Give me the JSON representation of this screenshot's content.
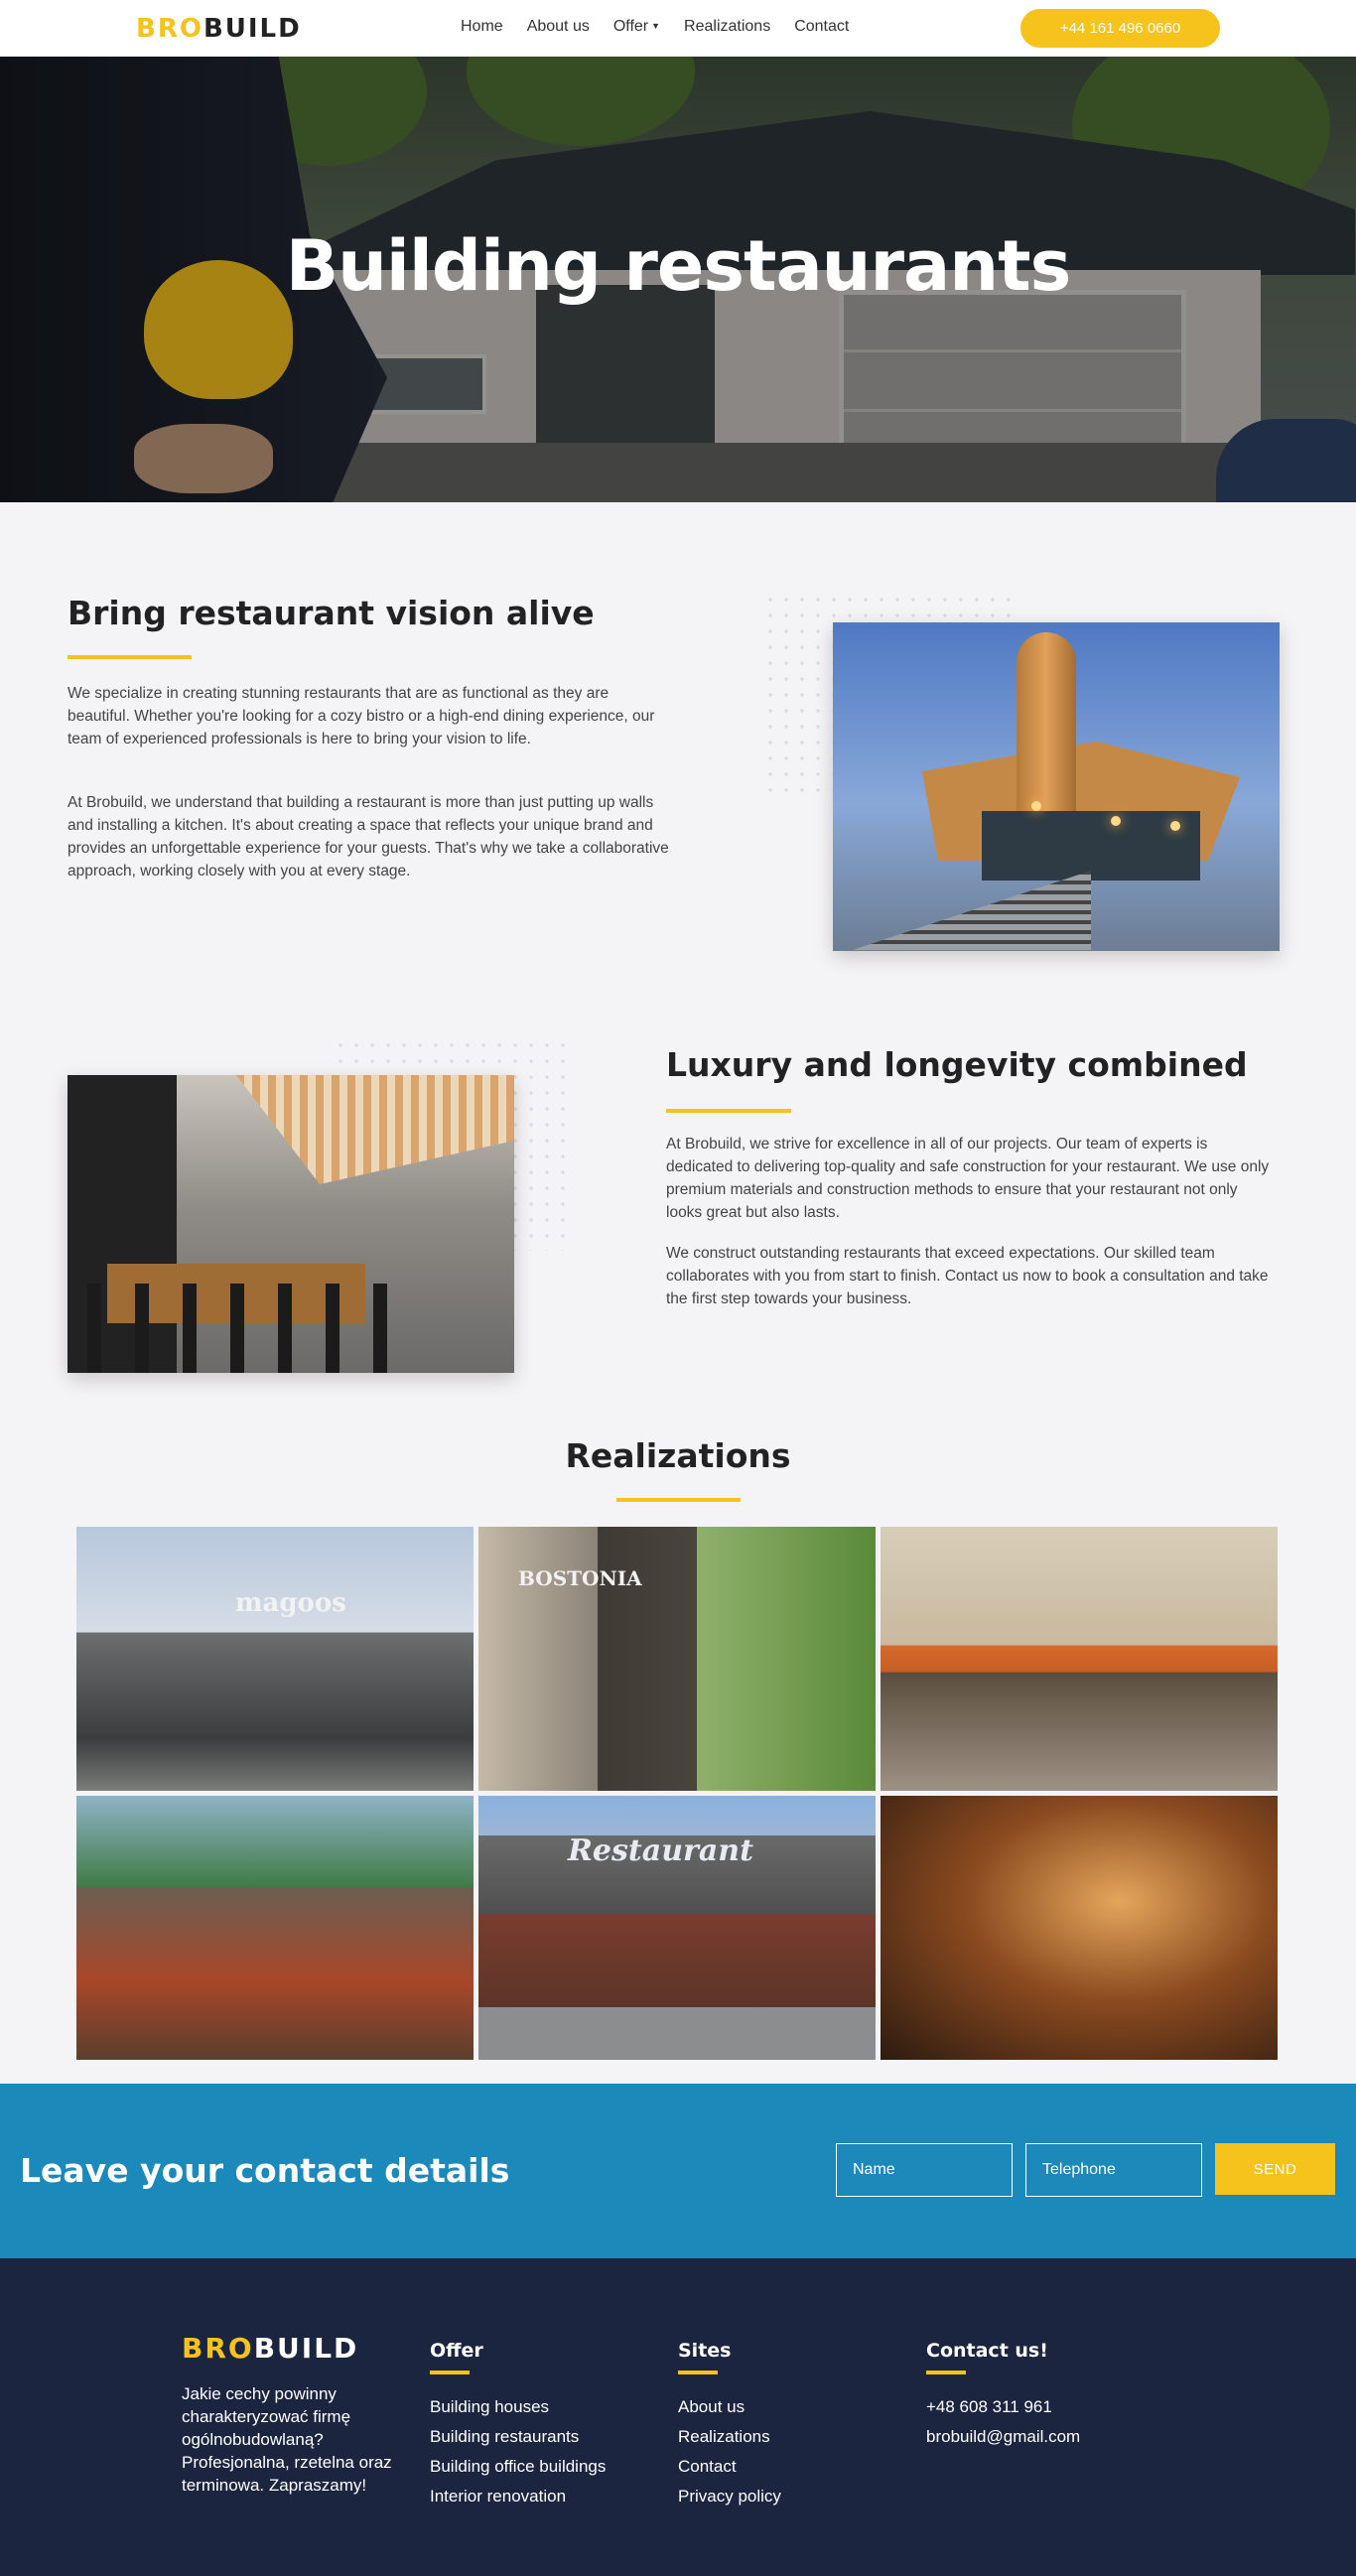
{
  "brand": {
    "part1": "BRO",
    "part2": "BUILD"
  },
  "nav": {
    "items": [
      "Home",
      "About us",
      "Offer",
      "Realizations",
      "Contact"
    ],
    "phone": "+44 161 496 0660"
  },
  "hero": {
    "title": "Building restaurants"
  },
  "section1": {
    "title": "Bring restaurant vision alive",
    "p1": "We specialize in creating stunning restaurants that are as functional as they are beautiful. Whether you're looking for a cozy bistro or a high-end dining experience, our team of experienced professionals is here to bring your vision to life.",
    "p2": "At Brobuild, we understand that building a restaurant is more than just putting up walls and installing a kitchen. It's about creating a space that reflects your unique brand and provides an unforgettable experience for your guests. That's why we take a collaborative approach, working closely with you at every stage."
  },
  "section2": {
    "title": "Luxury and longevity combined",
    "p1": "At Brobuild, we strive for excellence in all of our projects. Our team of experts is dedicated to delivering top-quality and safe construction for your restaurant. We use only premium materials and construction methods to ensure that your restaurant not only looks great but also lasts.",
    "p2": "We construct outstanding restaurants that exceed expectations. Our skilled team collaborates with you from start to finish. Contact us now to book a consultation and take the first step towards your business."
  },
  "realizations": {
    "title": "Realizations",
    "signs": {
      "magoos": "magoos",
      "bostonia": "BOSTONIA",
      "restaurant": "Restaurant"
    }
  },
  "cta": {
    "title": "Leave your contact details",
    "name_placeholder": "Name",
    "phone_placeholder": "Telephone",
    "send": "SEND"
  },
  "footer": {
    "description": "Jakie cechy powinny charakteryzować firmę ogólnobudowlaną? Profesjonalna, rzetelna oraz terminowa. Zapraszamy!",
    "offer": {
      "title": "Offer",
      "items": [
        "Building houses",
        "Building restaurants",
        "Building office buildings",
        "Interior renovation"
      ]
    },
    "sites": {
      "title": "Sites",
      "items": [
        "About us",
        "Realizations",
        "Contact",
        "Privacy policy"
      ]
    },
    "contact": {
      "title": "Contact us!",
      "items": [
        "+48 608 311 961",
        "brobuild@gmail.com"
      ]
    }
  },
  "colors": {
    "accent": "#f6c21c",
    "cta_bg": "#1b89b9",
    "footer_bg": "#1b2540",
    "page_bg": "#f4f3f5"
  }
}
